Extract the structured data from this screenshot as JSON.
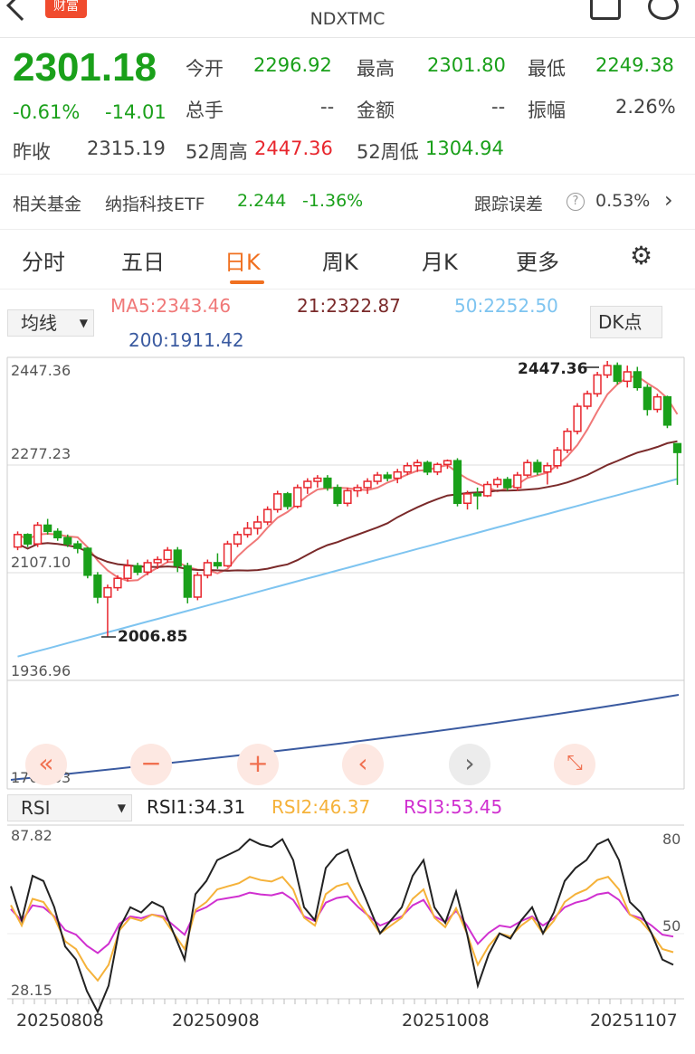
{
  "header": {
    "title": "NDXTMC",
    "logo_text": "财富"
  },
  "quote": {
    "price": "2301.18",
    "change_pct": "-0.61%",
    "change": "-14.01",
    "open_label": "今开",
    "open": "2296.92",
    "high_label": "最高",
    "high": "2301.80",
    "low_label": "最低",
    "low": "2249.38",
    "volume_label": "总手",
    "volume": "--",
    "amount_label": "金额",
    "amount": "--",
    "amplitude_label": "振幅",
    "amplitude": "2.26%",
    "prev_close_label": "昨收",
    "prev_close": "2315.19",
    "w52_high_label": "52周高",
    "w52_high": "2447.36",
    "w52_low_label": "52周低",
    "w52_low": "1304.94"
  },
  "fund": {
    "label": "相关基金",
    "name": "纳指科技ETF",
    "price": "2.244",
    "change": "-1.36%",
    "tracking_label": "跟踪误差",
    "tracking": "0.53%"
  },
  "tabs": [
    "分时",
    "五日",
    "日K",
    "周K",
    "月K",
    "更多"
  ],
  "active_tab": "日K",
  "ma": {
    "selector": "均线",
    "ma5": "MA5:2343.46",
    "ma21": "21:2322.87",
    "ma50": "50:2252.50",
    "ma200": "200:1911.42",
    "dk": "DK点"
  },
  "axis": {
    "top": "2447.36",
    "mid": "2277.23",
    "low_mid": "2107.10",
    "bottom": "1936.96",
    "ma_bottom": "1766.83",
    "max_annot": "2447.36",
    "min_annot": "2006.85"
  },
  "rsi": {
    "selector": "RSI",
    "rsi1": "RSI1:34.31",
    "rsi2": "RSI2:46.37",
    "rsi3": "RSI3:53.45",
    "top": "87.82",
    "bottom": "28.15",
    "l80": "80",
    "l50": "50"
  },
  "dates": [
    "20250808",
    "20250908",
    "20251008",
    "20251107"
  ],
  "colors": {
    "up": "#e8262d",
    "down": "#1aa01a",
    "ma5": "#f07878",
    "ma21": "#7a2a2a",
    "ma50": "#7ec4f0",
    "ma200": "#3a5aa0",
    "rsi1": "#222222",
    "rsi2": "#f5b23a",
    "rsi3": "#d030d0"
  },
  "chart_data": {
    "type": "candlestick",
    "ohlc": [
      [
        2150,
        2175,
        2145,
        2170
      ],
      [
        2170,
        2172,
        2150,
        2155
      ],
      [
        2155,
        2190,
        2150,
        2185
      ],
      [
        2185,
        2195,
        2170,
        2175
      ],
      [
        2175,
        2180,
        2160,
        2165
      ],
      [
        2165,
        2170,
        2150,
        2155
      ],
      [
        2155,
        2160,
        2140,
        2148
      ],
      [
        2148,
        2150,
        2100,
        2105
      ],
      [
        2105,
        2110,
        2060,
        2070
      ],
      [
        2070,
        2090,
        2006.85,
        2085
      ],
      [
        2085,
        2105,
        2080,
        2100
      ],
      [
        2100,
        2130,
        2095,
        2120
      ],
      [
        2120,
        2125,
        2105,
        2110
      ],
      [
        2110,
        2130,
        2105,
        2125
      ],
      [
        2125,
        2135,
        2115,
        2130
      ],
      [
        2130,
        2150,
        2125,
        2145
      ],
      [
        2145,
        2150,
        2110,
        2120
      ],
      [
        2120,
        2125,
        2060,
        2070
      ],
      [
        2070,
        2110,
        2065,
        2105
      ],
      [
        2105,
        2130,
        2100,
        2125
      ],
      [
        2125,
        2140,
        2115,
        2120
      ],
      [
        2120,
        2160,
        2118,
        2155
      ],
      [
        2155,
        2175,
        2150,
        2170
      ],
      [
        2170,
        2190,
        2165,
        2180
      ],
      [
        2180,
        2200,
        2170,
        2190
      ],
      [
        2190,
        2215,
        2185,
        2210
      ],
      [
        2210,
        2240,
        2205,
        2235
      ],
      [
        2235,
        2238,
        2210,
        2215
      ],
      [
        2215,
        2250,
        2212,
        2245
      ],
      [
        2245,
        2260,
        2235,
        2255
      ],
      [
        2255,
        2265,
        2245,
        2260
      ],
      [
        2260,
        2265,
        2240,
        2245
      ],
      [
        2245,
        2250,
        2215,
        2220
      ],
      [
        2220,
        2245,
        2215,
        2240
      ],
      [
        2240,
        2250,
        2230,
        2245
      ],
      [
        2245,
        2260,
        2235,
        2255
      ],
      [
        2255,
        2270,
        2250,
        2265
      ],
      [
        2265,
        2270,
        2255,
        2260
      ],
      [
        2260,
        2275,
        2252,
        2270
      ],
      [
        2270,
        2285,
        2265,
        2280
      ],
      [
        2280,
        2290,
        2270,
        2285
      ],
      [
        2285,
        2288,
        2265,
        2270
      ],
      [
        2270,
        2285,
        2265,
        2282
      ],
      [
        2282,
        2290,
        2275,
        2288
      ],
      [
        2288,
        2292,
        2215,
        2220
      ],
      [
        2220,
        2240,
        2210,
        2235
      ],
      [
        2235,
        2245,
        2210,
        2232
      ],
      [
        2232,
        2255,
        2230,
        2250
      ],
      [
        2250,
        2262,
        2245,
        2258
      ],
      [
        2258,
        2262,
        2240,
        2245
      ],
      [
        2245,
        2270,
        2240,
        2265
      ],
      [
        2265,
        2290,
        2262,
        2285
      ],
      [
        2285,
        2290,
        2265,
        2270
      ],
      [
        2270,
        2285,
        2250,
        2280
      ],
      [
        2280,
        2310,
        2275,
        2305
      ],
      [
        2305,
        2340,
        2300,
        2335
      ],
      [
        2335,
        2380,
        2330,
        2375
      ],
      [
        2375,
        2400,
        2370,
        2395
      ],
      [
        2395,
        2430,
        2390,
        2425
      ],
      [
        2425,
        2447.36,
        2420,
        2440
      ],
      [
        2440,
        2445,
        2410,
        2415
      ],
      [
        2415,
        2440,
        2405,
        2430
      ],
      [
        2430,
        2438,
        2400,
        2405
      ],
      [
        2405,
        2410,
        2360,
        2370
      ],
      [
        2370,
        2395,
        2365,
        2390
      ],
      [
        2390,
        2392,
        2340,
        2345
      ],
      [
        2315.19,
        2301.8,
        2249.38,
        2301.18
      ]
    ],
    "x": [
      "20250808",
      "20250908",
      "20251008",
      "20251107"
    ],
    "ylim": [
      1936.96,
      2447.36
    ]
  }
}
